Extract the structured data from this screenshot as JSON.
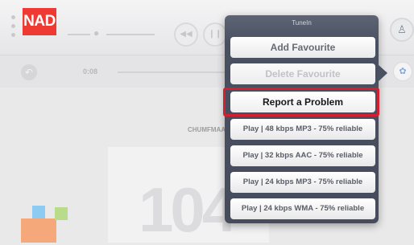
{
  "app": {
    "logo": "NAD"
  },
  "player": {
    "elapsed": "0:08",
    "station": "CHUMFMAA"
  },
  "artwork": {
    "text": "104"
  },
  "popover": {
    "title": "TuneIn",
    "items": [
      {
        "label": "Add Favourite",
        "enabled": true
      },
      {
        "label": "Delete Favourite",
        "enabled": false
      },
      {
        "label": "Report a Problem",
        "enabled": true,
        "highlighted": true
      },
      {
        "label": "Play | 48 kbps MP3 - 75% reliable",
        "enabled": true
      },
      {
        "label": "Play | 32 kbps AAC - 75% reliable",
        "enabled": true
      },
      {
        "label": "Play | 24 kbps MP3 - 75% reliable",
        "enabled": true
      },
      {
        "label": "Play | 24 kbps WMA - 75% reliable",
        "enabled": true
      }
    ]
  },
  "icons": {
    "grip": "grip-dots-icon",
    "volume": "speaker-icon",
    "previous": "previous-icon",
    "pause": "pause-icon",
    "profile": "user-icon",
    "back": "back-arrow-icon",
    "share": "share-icon"
  },
  "colors": {
    "brand": "#ee3a33",
    "highlight_border": "#d41f2e",
    "popover_bg": "#464c5c"
  }
}
